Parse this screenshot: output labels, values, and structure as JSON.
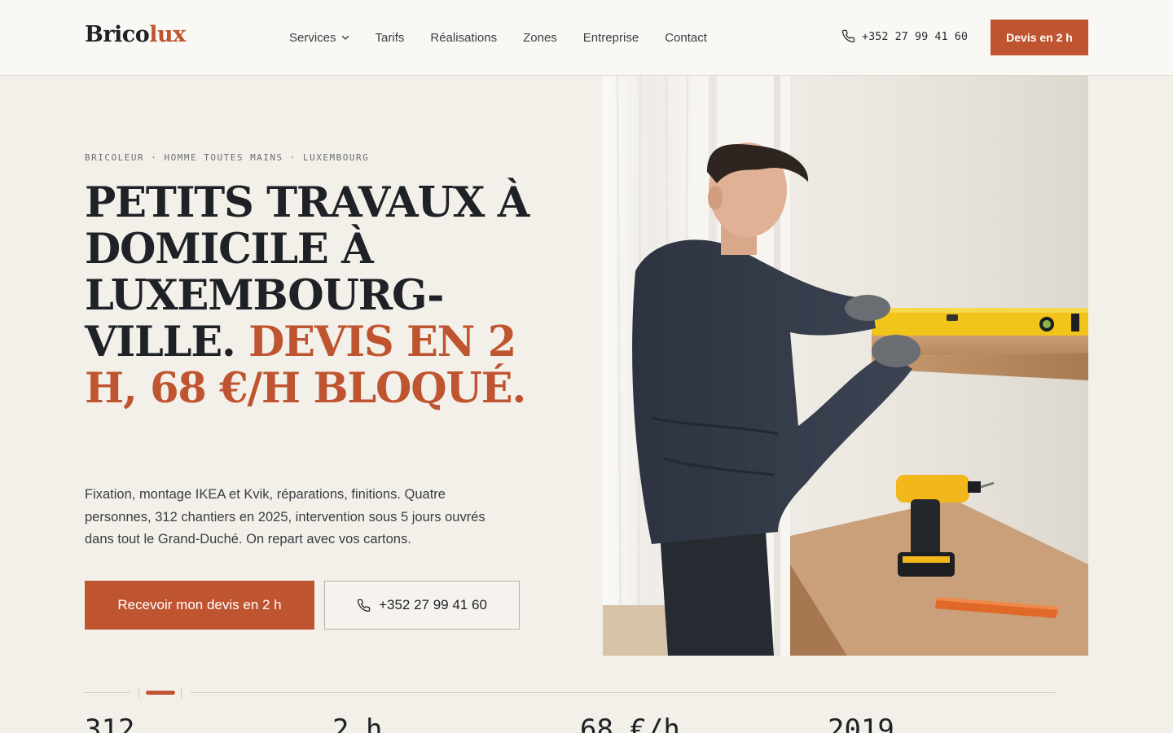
{
  "brand": {
    "name_part1": "Brico",
    "name_part2": "lux"
  },
  "nav": {
    "items": [
      {
        "label": "Services",
        "has_dropdown": true
      },
      {
        "label": "Tarifs"
      },
      {
        "label": "Réalisations"
      },
      {
        "label": "Zones"
      },
      {
        "label": "Entreprise"
      },
      {
        "label": "Contact"
      }
    ]
  },
  "header": {
    "phone": "+352 27 99 41 60",
    "cta_label": "Devis en 2 h"
  },
  "hero": {
    "eyebrow": "BRICOLEUR · HOMME TOUTES MAINS · LUXEMBOURG",
    "headline_main": "PETITS TRAVAUX À DOMICILE À LUXEMBOURG-VILLE.",
    "headline_accent": "DEVIS EN 2 H, 68 €/H BLOQUÉ.",
    "intro": "Fixation, montage IKEA et Kvik, réparations, finitions. Quatre personnes, 312 chantiers en 2025, intervention sous 5 jours ouvrés dans tout le Grand-Duché. On repart avec vos cartons.",
    "primary_cta": "Recevoir mon devis en 2 h",
    "secondary_cta_phone": "+352 27 99 41 60"
  },
  "stats": {
    "values": [
      "312",
      "2 h",
      "68 €/h",
      "2019"
    ]
  },
  "colors": {
    "accent": "#bf5530",
    "background": "#f3f0ea",
    "header_background": "#faf8f4",
    "text": "#1e2126"
  },
  "icons": {
    "phone": "phone-icon",
    "dropdown": "chevron-down-icon"
  }
}
